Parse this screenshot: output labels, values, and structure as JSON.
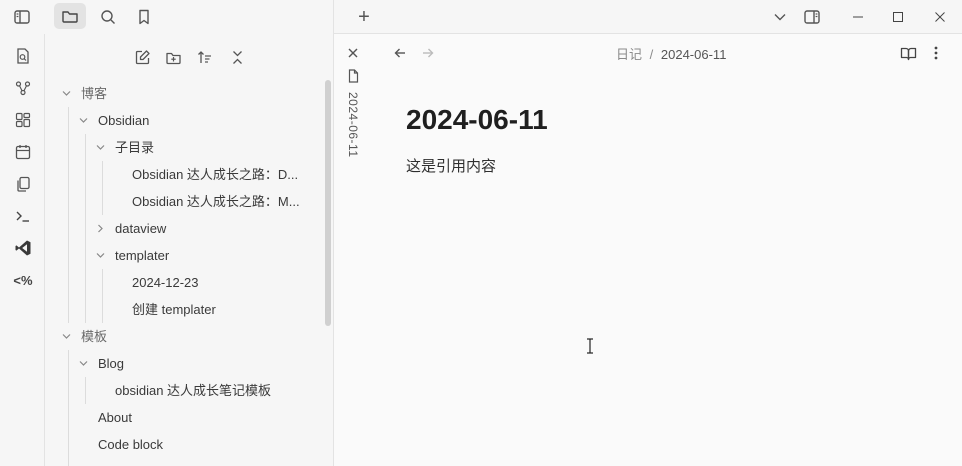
{
  "tabbar": {
    "new_tab_label": "+"
  },
  "sidebar": {
    "tree": [
      {
        "label": "博客"
      },
      {
        "label": "Obsidian"
      },
      {
        "label": "子目录"
      },
      {
        "label": "Obsidian 达人成长之路：D..."
      },
      {
        "label": "Obsidian 达人成长之路：M..."
      },
      {
        "label": "dataview"
      },
      {
        "label": "templater"
      },
      {
        "label": "2024-12-23"
      },
      {
        "label": "创建 templater"
      },
      {
        "label": "模板"
      },
      {
        "label": "Blog"
      },
      {
        "label": "obsidian 达人成长笔记模板"
      },
      {
        "label": "About"
      },
      {
        "label": "Code block"
      }
    ]
  },
  "ribbon": {
    "templater_label": "<%"
  },
  "editor": {
    "breadcrumb_folder": "日记",
    "breadcrumb_sep": "/",
    "breadcrumb_file": "2024-06-11",
    "stacked_tab_title": "2024-06-11",
    "note_title": "2024-06-11",
    "note_body": "这是引用内容"
  },
  "colors": {
    "background": "#f6f6f6",
    "editor_bg": "#fafafa",
    "border": "#e3e3e3",
    "text": "#2e2e2e",
    "muted": "#8a8a8a"
  }
}
